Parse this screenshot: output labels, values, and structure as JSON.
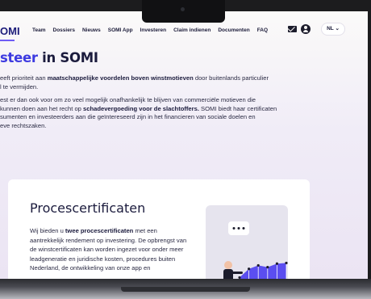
{
  "header": {
    "logo_text": "OMI",
    "nav_items": [
      "Team",
      "Dossiers",
      "Nieuws",
      "SOMI App",
      "Investeren",
      "Claim indienen",
      "Documenten",
      "FAQ"
    ],
    "language": "NL ⌄"
  },
  "hero": {
    "title_accent": "steer",
    "title_rest": " in SOMI",
    "paragraph1": {
      "pre": "eeft prioriteit aan ",
      "bold": "maatschappelijke voordelen boven winstmotieven",
      "post": " door buitenlands particulier",
      "line2": "l te vermijden."
    },
    "paragraph2": {
      "line1": "est er dan ook voor om zo veel mogelijk onafhankelijk te blijven van commerciële motieven die",
      "line2_pre": " kunnen doen aan het recht op ",
      "line2_bold": "schadevergoeding voor de slachtoffers.",
      "line2_post": " SOMI biedt haar certificaten",
      "line3": "sumenten en investeerders aan die geïntereseerd zijn in het financieren van sociale doelen en",
      "line4": "eve rechtszaken."
    }
  },
  "card": {
    "title": "Procescertificaten",
    "text_pre": "Wij bieden u ",
    "text_bold": "twee procescertificaten",
    "text_post": " met een aantrekkelijk rendement op investering. De opbrengst van de winstcertificaten kan worden ingezet voor onder meer leadgeneratie en juridische kosten, procedures buiten Nederland, de ontwikkeling van onze app en"
  },
  "illustration": {
    "chart_values": [
      20,
      45,
      55,
      50,
      60,
      62
    ],
    "colors": {
      "area": "#5b4ef0",
      "person": "#1c1c2c",
      "shirt": "#f2c2a6"
    }
  }
}
